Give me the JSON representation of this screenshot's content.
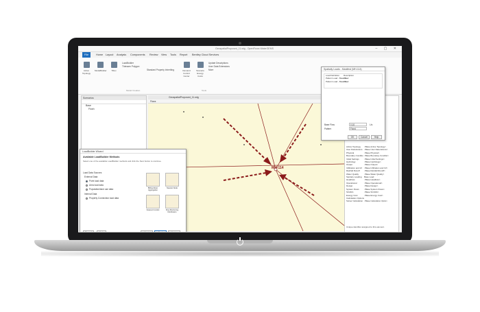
{
  "app": {
    "title": "GeospatialProposed_11.wtg - OpenFlows WaterGEMS",
    "menu": [
      "File",
      "Home",
      "Layout",
      "Analysis",
      "Components",
      "Review",
      "View",
      "Tools",
      "Report",
      "Bentley Cloud Services"
    ],
    "ribbon": {
      "buttons": [
        "Active Topology",
        "ModelBuilder",
        "TRex",
        "LoadBuilder",
        "Thiessen Polygon",
        "Demand Control Center",
        "Scenario Energy Costs",
        "Update Descriptions"
      ],
      "small": [
        "LoadBuilder",
        "Thiessen Polygon",
        "Standard Property Inheriting",
        "User Data Extensions",
        "More"
      ],
      "groups": [
        "Model Creation",
        "Tools"
      ]
    }
  },
  "left_panel": {
    "title": "Scenarios",
    "items": [
      "Base",
      "Flush"
    ]
  },
  "map": {
    "tab": "GeospatialProposed_11.wtg",
    "label": "MH-114",
    "zoom_label": "Flows"
  },
  "property_panel": {
    "rows": [
      {
        "k": "Active Topology",
        "v": "<Base Active Topology>"
      },
      {
        "k": "User Data Extens",
        "v": "<Base User Data Extens>"
      },
      {
        "k": "Physical",
        "v": "<Base Physical>"
      },
      {
        "k": "Boundary Conditio",
        "v": "<Base Boundary Conditio>"
      },
      {
        "k": "Initial Settings",
        "v": "<Base Initial Settings>"
      },
      {
        "k": "Hydrology",
        "v": "<Base Hydrology>"
      },
      {
        "k": "Output",
        "v": "<Base Output>"
      },
      {
        "k": "Infiltration and Inf",
        "v": "<Base Infiltration and Inf>"
      },
      {
        "k": "Rainfall Runoff",
        "v": "<Base Rainfall Runoff>"
      },
      {
        "k": "Water Quality",
        "v": "<Base Water Quality>"
      },
      {
        "k": "Sanitary Loading",
        "v": "Base Load"
      },
      {
        "k": "Headloss",
        "v": "<Base Headloss>"
      },
      {
        "k": "Operational",
        "v": "<Base Operational>"
      },
      {
        "k": "Design",
        "v": "<Base Design>"
      },
      {
        "k": "System Flows",
        "v": "<Base System Flows>"
      },
      {
        "k": "SCADA",
        "v": "<Base SCADA>"
      },
      {
        "k": "Energy Cost",
        "v": "<Base Energy Cost>"
      },
      {
        "k": "Calculation Options",
        "v": ""
      },
      {
        "k": "Solver Calculation",
        "v": "<Base Calculation Optio>"
      }
    ],
    "note": "Unique identifier assigned to this element."
  },
  "spatial_dialog": {
    "title": "Spatially Loads - Manifest (MH-114)",
    "rows": [
      {
        "k": "Load Definition",
        "v": "Description"
      },
      {
        "k": "Pattern Load - Base Fl...",
        "v": "Fixed"
      },
      {
        "k": "Pattern Load - Base Fl...",
        "v": "Fixed"
      }
    ],
    "base_flow_label": "Base Flow",
    "base_flow_value": "0.10",
    "base_flow_unit": "L/s",
    "pattern_label": "Pattern",
    "pattern_value": "Fixed",
    "ok": "OK",
    "cancel": "Cancel",
    "help": "Help"
  },
  "wizard": {
    "title": "LoadBuilder Wizard",
    "heading": "Available LoadBuilder Methods",
    "subtitle": "Select one of the available LoadBuilder methods and click the Next button to continue.",
    "section_label": "Load Data Sources",
    "external_label": "External Data",
    "options": [
      {
        "label": "Point load data",
        "selected": true
      },
      {
        "label": "Area load data",
        "selected": false
      },
      {
        "label": "Population/land use data",
        "selected": false
      }
    ],
    "internal_label": "Internal Data",
    "internal_option": "Property Connection load data",
    "tiles": [
      "Billing Meter Aggregation",
      "Nearest Node",
      "Nearest Conduit",
      "Flow Monitoring Distribution"
    ],
    "buttons": {
      "cancel": "Cancel",
      "help": "Help",
      "back": "Back",
      "next": "Next",
      "finish": "Finish"
    }
  },
  "status": {
    "coords": "X: 258,874.36 m, Y: 98,973.49 m",
    "zoom": "Zoom Level: 72.5 %"
  },
  "colors": {
    "accent": "#1f6fbf",
    "map_bg": "#fbf8d8",
    "arrow": "#8b1a1a"
  }
}
